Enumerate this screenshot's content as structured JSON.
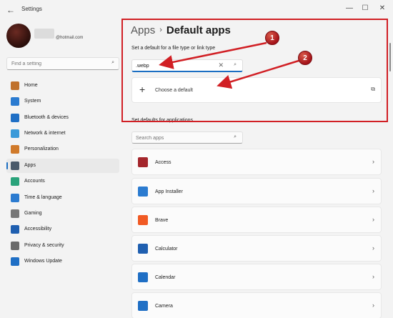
{
  "window": {
    "title": "Settings",
    "back_glyph": "←",
    "minimize_glyph": "—",
    "maximize_glyph": "☐",
    "close_glyph": "✕"
  },
  "account": {
    "email": "@hotmail.com"
  },
  "sidebar": {
    "search_placeholder": "Find a setting",
    "items": [
      {
        "label": "Home",
        "icon": "home-icon",
        "color": "#c0712c"
      },
      {
        "label": "System",
        "icon": "system-icon",
        "color": "#2b7bd0"
      },
      {
        "label": "Bluetooth & devices",
        "icon": "bluetooth-icon",
        "color": "#1f6fc5"
      },
      {
        "label": "Network & internet",
        "icon": "network-icon",
        "color": "#3a9ad9"
      },
      {
        "label": "Personalization",
        "icon": "brush-icon",
        "color": "#d07a2a"
      },
      {
        "label": "Apps",
        "icon": "apps-icon",
        "color": "#4a5a6b"
      },
      {
        "label": "Accounts",
        "icon": "accounts-icon",
        "color": "#2aa37b"
      },
      {
        "label": "Time & language",
        "icon": "time-language-icon",
        "color": "#2b7bd0"
      },
      {
        "label": "Gaming",
        "icon": "gaming-icon",
        "color": "#777777"
      },
      {
        "label": "Accessibility",
        "icon": "accessibility-icon",
        "color": "#1f5fb0"
      },
      {
        "label": "Privacy & security",
        "icon": "shield-icon",
        "color": "#6b6b6b"
      },
      {
        "label": "Windows Update",
        "icon": "windows-update-icon",
        "color": "#1f6fc5"
      }
    ],
    "active_index": 5
  },
  "breadcrumb": {
    "parent": "Apps",
    "separator": "›",
    "current": "Default apps"
  },
  "file_type_section": {
    "label": "Set a default for a file type or link type",
    "input_value": ".webp",
    "clear_glyph": "✕",
    "search_glyph": "⌕",
    "choose_label": "Choose a default",
    "plus_glyph": "+",
    "external_glyph": "⧉"
  },
  "apps_section": {
    "label": "Set defaults for applications",
    "search_placeholder": "Search apps",
    "search_glyph": "⌕",
    "chevron_glyph": "›",
    "apps": [
      {
        "name": "Access",
        "icon": "access-icon",
        "color": "#a4262c"
      },
      {
        "name": "App Installer",
        "icon": "app-installer-icon",
        "color": "#2b7bd0"
      },
      {
        "name": "Brave",
        "icon": "brave-icon",
        "color": "#f15a24"
      },
      {
        "name": "Calculator",
        "icon": "calculator-icon",
        "color": "#1f5fb0"
      },
      {
        "name": "Calendar",
        "icon": "calendar-icon",
        "color": "#1f6fc5"
      },
      {
        "name": "Camera",
        "icon": "camera-icon",
        "color": "#1f6fc5"
      }
    ]
  },
  "annotations": {
    "badge_1": "1",
    "badge_2": "2",
    "color": "#d11f24"
  }
}
